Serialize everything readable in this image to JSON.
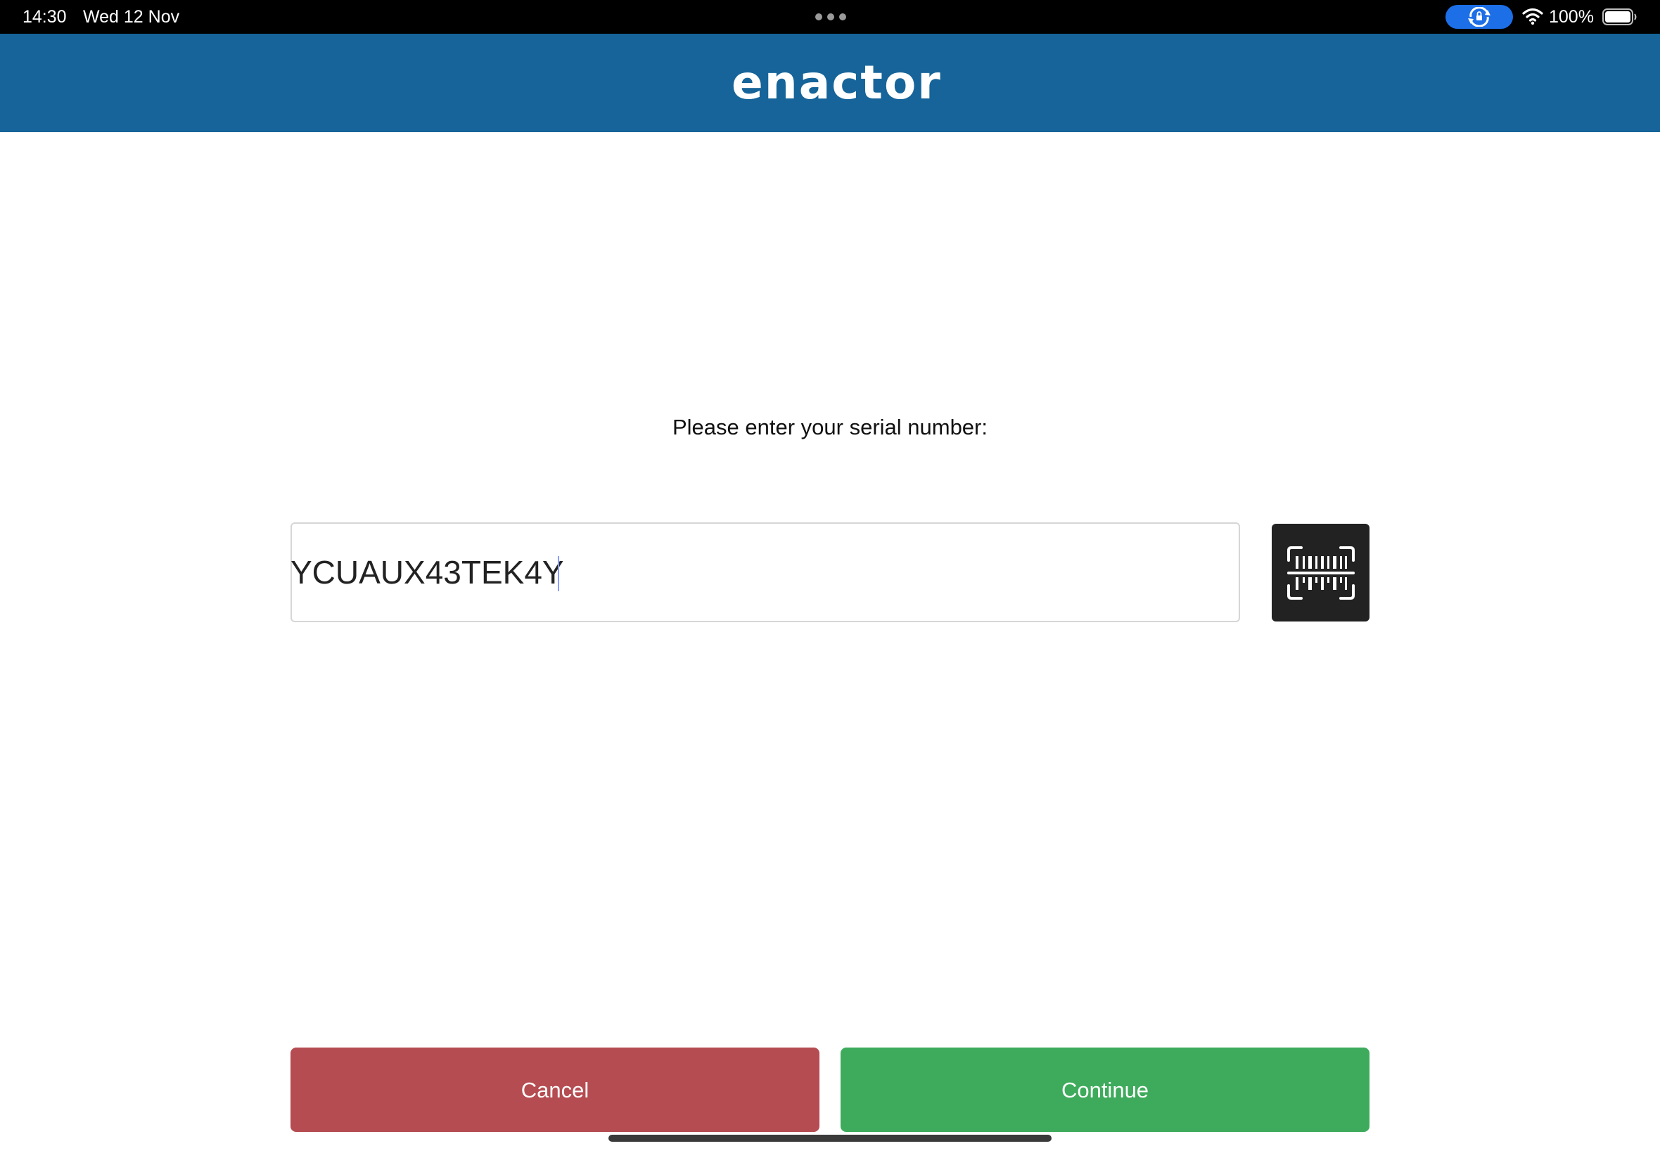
{
  "status_bar": {
    "time": "14:30",
    "date": "Wed 12 Nov",
    "battery_percent": "100%",
    "icons": [
      "multitask-dots-icon",
      "rotation-lock-icon",
      "wifi-icon",
      "battery-icon"
    ]
  },
  "header": {
    "brand": "enactor",
    "background_color": "#166499"
  },
  "main": {
    "prompt": "Please enter your serial number:",
    "serial_input": {
      "value": "YCUAUX43TEK4Y",
      "placeholder": ""
    },
    "scan_button_icon": "barcode-scan-icon"
  },
  "actions": {
    "cancel_label": "Cancel",
    "continue_label": "Continue",
    "cancel_color": "#b54c51",
    "continue_color": "#3eab5c"
  }
}
